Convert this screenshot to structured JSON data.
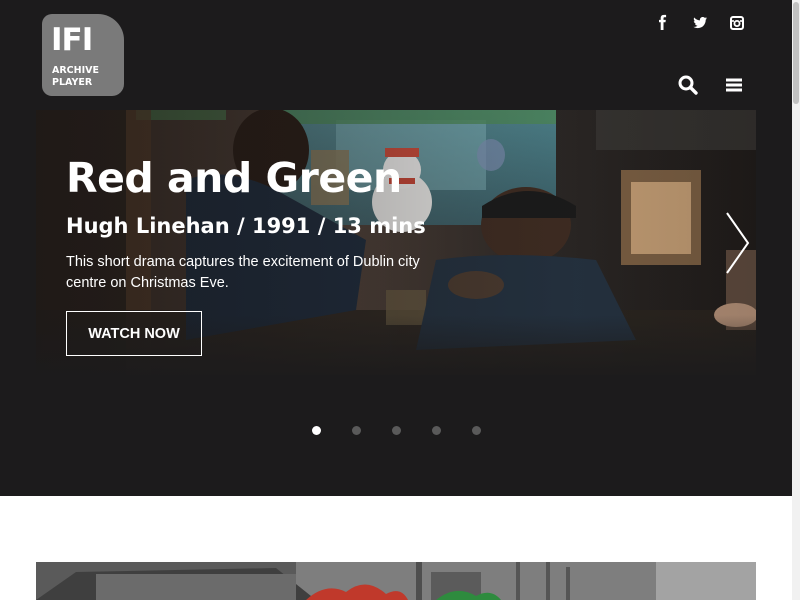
{
  "logo": {
    "title": "IFI",
    "subtitle_line1": "ARCHIVE",
    "subtitle_line2": "PLAYER"
  },
  "social": [
    {
      "icon": "facebook-icon"
    },
    {
      "icon": "twitter-icon"
    },
    {
      "icon": "instagram-icon"
    }
  ],
  "header": {
    "search_icon": "search-icon",
    "menu_icon": "hamburger-menu-icon"
  },
  "hero": {
    "title": "Red and Green",
    "meta": "Hugh Linehan / 1991 / 13 mins",
    "description": "This short drama captures the excitement of Dublin city centre on Christmas Eve.",
    "cta_label": "WATCH NOW",
    "next_icon": "chevron-right-icon"
  },
  "carousel": {
    "slide_count": 5,
    "active_index": 0
  },
  "colors": {
    "page_dark": "#1c1b1c",
    "logo_bg": "#7a7a7a",
    "dot_inactive": "#5a5a5a",
    "dot_active": "#ffffff"
  }
}
